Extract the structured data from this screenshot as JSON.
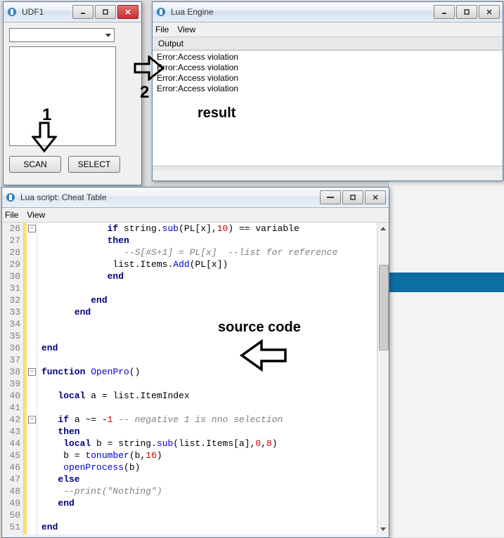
{
  "udf1": {
    "title": "UDF1",
    "buttons": {
      "scan": "SCAN",
      "select": "SELECT"
    }
  },
  "luaengine": {
    "title": "Lua Engine",
    "menu": {
      "file": "File",
      "view": "View"
    },
    "output_label": "Output",
    "errors": [
      "Error:Access violation",
      "Error:Access violation",
      "Error:Access violation",
      "Error:Access violation"
    ]
  },
  "luascript": {
    "title": "Lua script: Cheat Table",
    "menu": {
      "file": "File",
      "view": "View"
    },
    "first_line": 26,
    "code_lines": [
      {
        "n": 26,
        "fold": "minus",
        "raw": "            if string.sub(PL[x],10) == variable"
      },
      {
        "n": 27,
        "raw": "            then"
      },
      {
        "n": 28,
        "raw": "               --S[#S+1] = PL[x]  --list for reference"
      },
      {
        "n": 29,
        "raw": "             list.Items.Add(PL[x])"
      },
      {
        "n": 30,
        "raw": "            end"
      },
      {
        "n": 31,
        "raw": ""
      },
      {
        "n": 32,
        "raw": "         end"
      },
      {
        "n": 33,
        "raw": "      end"
      },
      {
        "n": 34,
        "raw": ""
      },
      {
        "n": 35,
        "raw": ""
      },
      {
        "n": 36,
        "raw": "end"
      },
      {
        "n": 37,
        "raw": ""
      },
      {
        "n": 38,
        "fold": "minus",
        "raw": "function OpenPro()"
      },
      {
        "n": 39,
        "raw": ""
      },
      {
        "n": 40,
        "raw": "   local a = list.ItemIndex"
      },
      {
        "n": 41,
        "raw": ""
      },
      {
        "n": 42,
        "fold": "minus",
        "raw": "   if a ~= -1 -- negative 1 is nno selection"
      },
      {
        "n": 43,
        "raw": "   then"
      },
      {
        "n": 44,
        "raw": "    local b = string.sub(list.Items[a],0,8)"
      },
      {
        "n": 45,
        "raw": "    b = tonumber(b,16)"
      },
      {
        "n": 46,
        "raw": "    openProcess(b)"
      },
      {
        "n": 47,
        "raw": "   else"
      },
      {
        "n": 48,
        "raw": "    --print(\"Nothing\")"
      },
      {
        "n": 49,
        "raw": "   end"
      },
      {
        "n": 50,
        "raw": ""
      },
      {
        "n": 51,
        "raw": "end"
      }
    ]
  },
  "annotations": {
    "one": "1",
    "two": "2",
    "result": "result",
    "source": "source code"
  }
}
